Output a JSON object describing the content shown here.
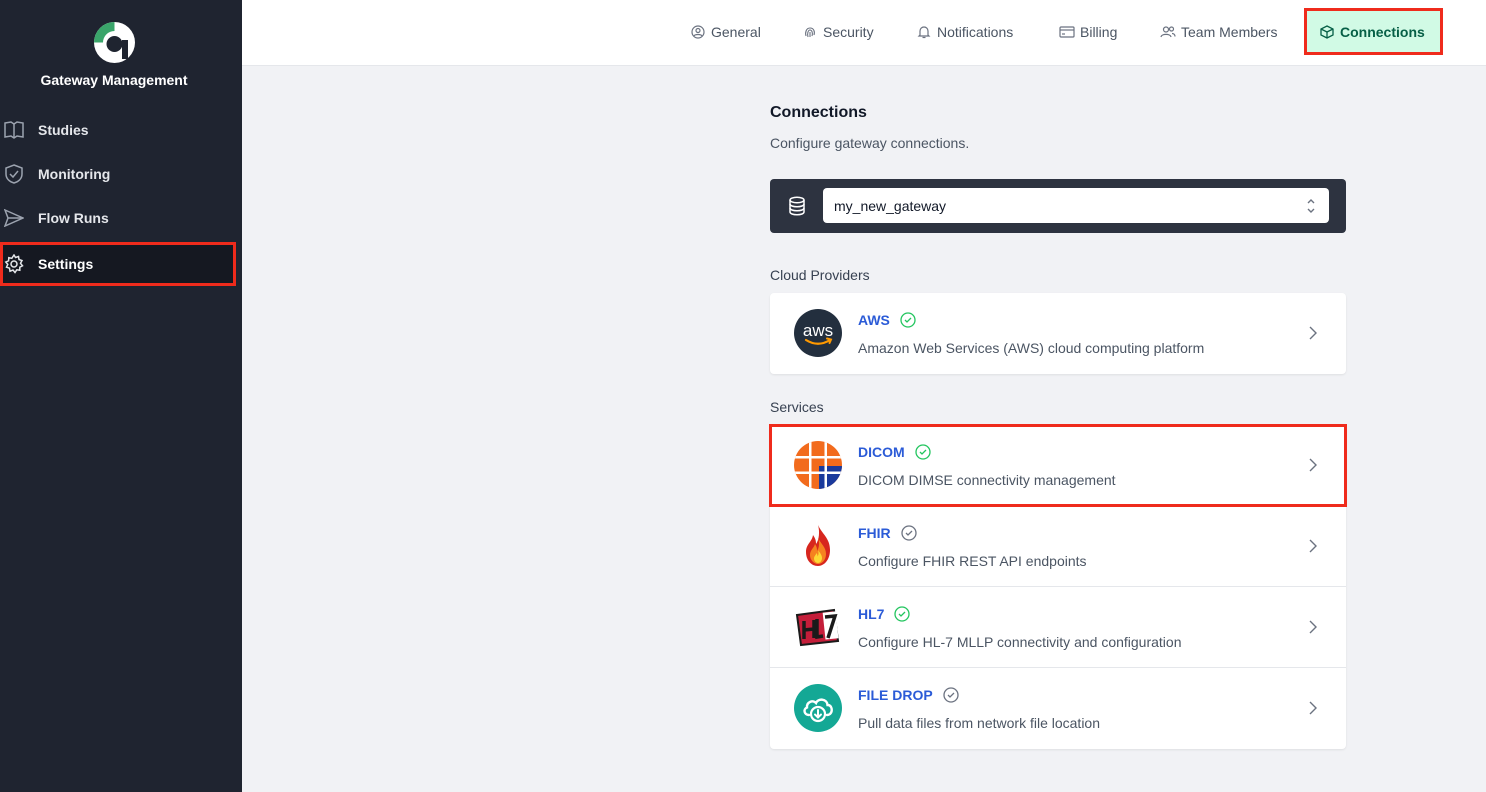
{
  "app": {
    "title": "Gateway Management"
  },
  "sidebar": {
    "items": [
      {
        "label": "Studies",
        "icon": "book-icon"
      },
      {
        "label": "Monitoring",
        "icon": "shield-check-icon"
      },
      {
        "label": "Flow Runs",
        "icon": "paper-plane-icon"
      },
      {
        "label": "Settings",
        "icon": "gear-icon",
        "active": true
      }
    ]
  },
  "tabs": [
    {
      "label": "General",
      "icon": "user-circle-icon"
    },
    {
      "label": "Security",
      "icon": "fingerprint-icon"
    },
    {
      "label": "Notifications",
      "icon": "bell-icon"
    },
    {
      "label": "Billing",
      "icon": "credit-card-icon"
    },
    {
      "label": "Team Members",
      "icon": "users-icon"
    },
    {
      "label": "Connections",
      "icon": "cube-icon",
      "active": true
    }
  ],
  "main": {
    "title": "Connections",
    "subtitle": "Configure gateway connections.",
    "gateway": {
      "selected": "my_new_gateway"
    },
    "cloud_providers_label": "Cloud Providers",
    "services_label": "Services",
    "cloud_providers": [
      {
        "name": "AWS",
        "description": "Amazon Web Services (AWS) cloud computing platform",
        "status": "connected"
      }
    ],
    "services": [
      {
        "name": "DICOM",
        "description": "DICOM DIMSE connectivity management",
        "status": "connected"
      },
      {
        "name": "FHIR",
        "description": "Configure FHIR REST API endpoints",
        "status": "inactive"
      },
      {
        "name": "HL7",
        "description": "Configure HL-7 MLLP connectivity and configuration",
        "status": "connected"
      },
      {
        "name": "FILE DROP",
        "description": "Pull data files from network file location",
        "status": "inactive"
      }
    ]
  },
  "colors": {
    "sidebar_bg": "#1f2430",
    "accent_link": "#2b5bd7",
    "status_connected": "#22c55e",
    "status_inactive": "#6b7280",
    "highlight": "#ef2b1c",
    "active_tab_bg": "#d1fae5"
  }
}
